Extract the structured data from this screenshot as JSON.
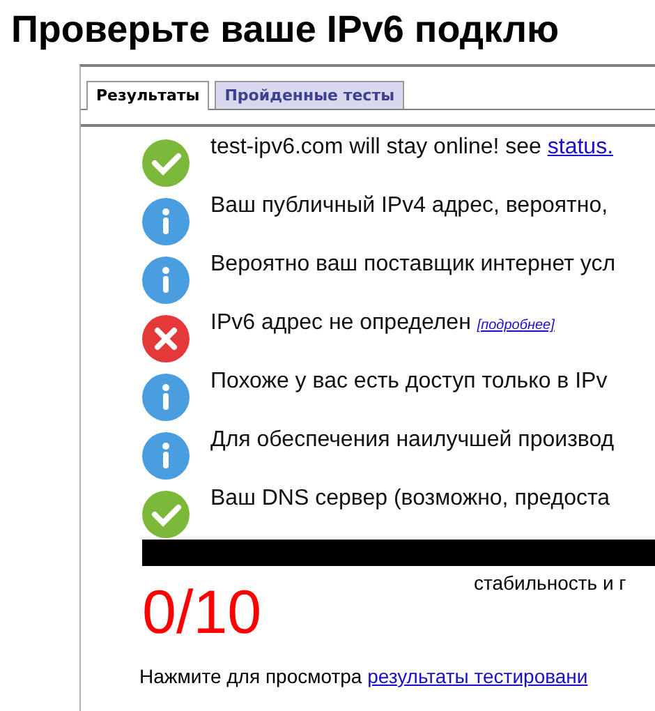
{
  "title": "Проверьте ваше IPv6 подклю",
  "tabs": [
    {
      "label": "Результаты",
      "selected": true
    },
    {
      "label": "Пройденные тесты",
      "selected": false
    }
  ],
  "results": [
    {
      "kind": "ok",
      "text": "test-ipv6.com will stay online! see ",
      "link": "status."
    },
    {
      "kind": "info",
      "text": "Ваш публичный IPv4 адрес, вероятно,"
    },
    {
      "kind": "info",
      "text": "Вероятно ваш поставщик интернет усл"
    },
    {
      "kind": "error",
      "text": "IPv6 адрес не определен ",
      "link": "[подробнее]"
    },
    {
      "kind": "info",
      "text": "Похоже у вас есть доступ только в IPv"
    },
    {
      "kind": "info",
      "text": "Для обеспечения наилучшей производ"
    },
    {
      "kind": "ok",
      "text": "Ваш DNS сервер (возможно, предоста"
    }
  ],
  "score": "0/10",
  "score_caption": "стабильность и г",
  "footer": {
    "text": "Нажмите для просмотра ",
    "link": "результаты тестировани"
  }
}
